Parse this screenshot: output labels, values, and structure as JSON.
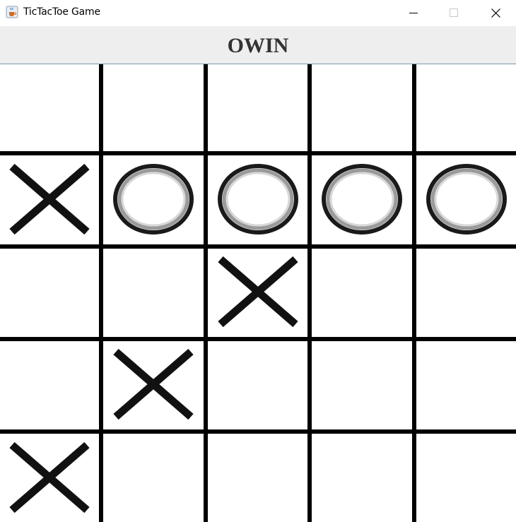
{
  "window": {
    "title": "TicTacToe Game",
    "icon": "java-cup-icon",
    "buttons": [
      "minimize-icon",
      "maximize-icon",
      "close-icon"
    ]
  },
  "status": {
    "text": "OWIN"
  },
  "board": {
    "rows": 5,
    "cols": 5,
    "cells": [
      [
        "",
        "",
        "",
        "",
        ""
      ],
      [
        "X",
        "O",
        "O",
        "O",
        "O"
      ],
      [
        "",
        "",
        "X",
        "",
        ""
      ],
      [
        "",
        "X",
        "",
        "",
        ""
      ],
      [
        "X",
        "",
        "",
        "",
        ""
      ]
    ]
  }
}
